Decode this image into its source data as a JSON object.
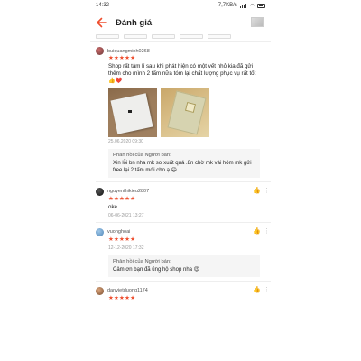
{
  "status": {
    "time": "14:32",
    "speed": "7,7KB/s"
  },
  "header": {
    "title": "Đánh giá"
  },
  "reviews": [
    {
      "username": "buiquangminh0268",
      "stars": "★★★★★",
      "text": "Shop rất tâm lí sau khi phát hiện có một vết nhỏ kia đã gửi thêm cho mình 2 tấm nữa tóm lại chất lượng phục vụ rất tốt 👍❤️",
      "date": "25.06.2020 09:30",
      "reply_title": "Phản hồi của Người bán:",
      "reply_text": "Xin lỗi bn nha mk sơ xuất quá .8n chờ mk vài hôm mk gửi free lại 2 tấm mới cho ạ 😄"
    },
    {
      "username": "nguyenthikieu2807",
      "stars": "★★★★★",
      "text": "oke",
      "date": "06-06-2021 13:27"
    },
    {
      "username": "vuonghoai",
      "stars": "★★★★★",
      "date": "12-12-2020 17:32",
      "reply_title": "Phản hồi của Người bán:",
      "reply_text": "Cảm ơn bạn đã ủng hộ shop nha 😍"
    },
    {
      "username": "danvietduong1174",
      "stars": "★★★★★"
    }
  ],
  "icons": {
    "back": "arrow-left-icon",
    "like": "thumbs-up-icon",
    "more": "more-vertical-icon"
  },
  "colors": {
    "accent": "#ee4d2d"
  }
}
